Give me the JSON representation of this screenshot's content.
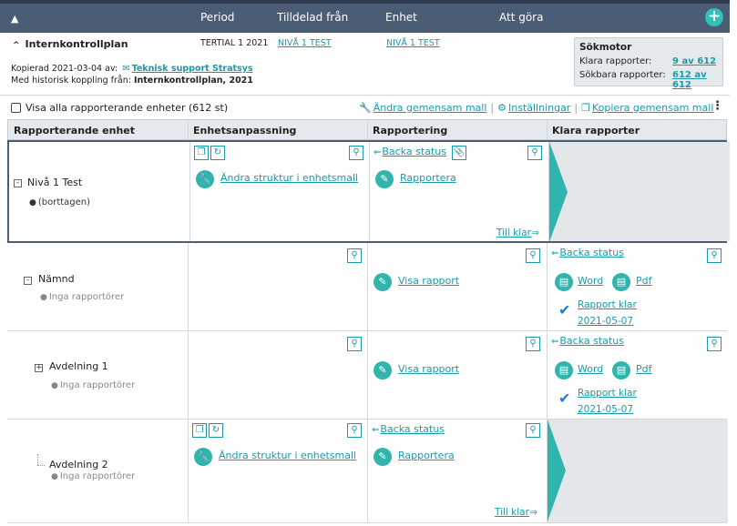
{
  "header": {
    "columns": {
      "period": "Period",
      "assigned": "Tilldelad från",
      "unit": "Enhet",
      "todo": "Att göra"
    },
    "add_icon": "plus-circle-icon"
  },
  "plan": {
    "title": "Internkontrollplan",
    "period": "TERTIAL 1 2021",
    "assigned_from": "NIVÅ 1 TEST",
    "unit": "NIVÅ 1 TEST",
    "copied_label": "Kopierad 2021-03-04 av:",
    "copied_by": "Teknisk support Stratsys",
    "history_label": "Med historisk koppling från:",
    "history_value": "Internkontrollplan, 2021"
  },
  "search_engine": {
    "title": "Sökmotor",
    "ready_label": "Klara rapporter:",
    "ready_value": "9 av 612",
    "searchable_label": "Sökbara rapporter:",
    "searchable_value": "612 av 612"
  },
  "toolbar": {
    "show_all_label": "Visa alla rapporterande enheter (612 st)",
    "change_template": "Ändra gemensam mall",
    "settings": "Inställningar",
    "copy_template": "Kopiera gemensam mall"
  },
  "table": {
    "headers": [
      "Rapporterande enhet",
      "Enhetsanpassning",
      "Rapportering",
      "Klara rapporter"
    ],
    "rows": [
      {
        "unit": "Nivå 1 Test",
        "sub": "(borttagen)",
        "adapt_link": "Ändra struktur i enhetsmall",
        "back": "Backa status",
        "report_link": "Rapportera",
        "till_klar": "Till klar"
      },
      {
        "unit": "Nämnd",
        "sub": "Inga rapportörer",
        "report_link": "Visa rapport",
        "back": "Backa status",
        "word": "Word",
        "pdf": "Pdf",
        "ready": "Rapport klar",
        "date": "2021-05-07"
      },
      {
        "unit": "Avdelning 1",
        "sub": "Inga rapportörer",
        "report_link": "Visa rapport",
        "back": "Backa status",
        "word": "Word",
        "pdf": "Pdf",
        "ready": "Rapport klar",
        "date": "2021-05-07"
      },
      {
        "unit": "Avdelning 2",
        "sub": "Inga rapportörer",
        "adapt_link": "Ändra struktur i enhetsmall",
        "back": "Backa status",
        "report_link": "Rapportera",
        "till_klar": "Till klar"
      }
    ]
  },
  "colors": {
    "header_bg": "#4b5d75",
    "accent": "#1a9aa8",
    "teal_button": "#2fb5ad",
    "check": "#1a7fd0"
  }
}
